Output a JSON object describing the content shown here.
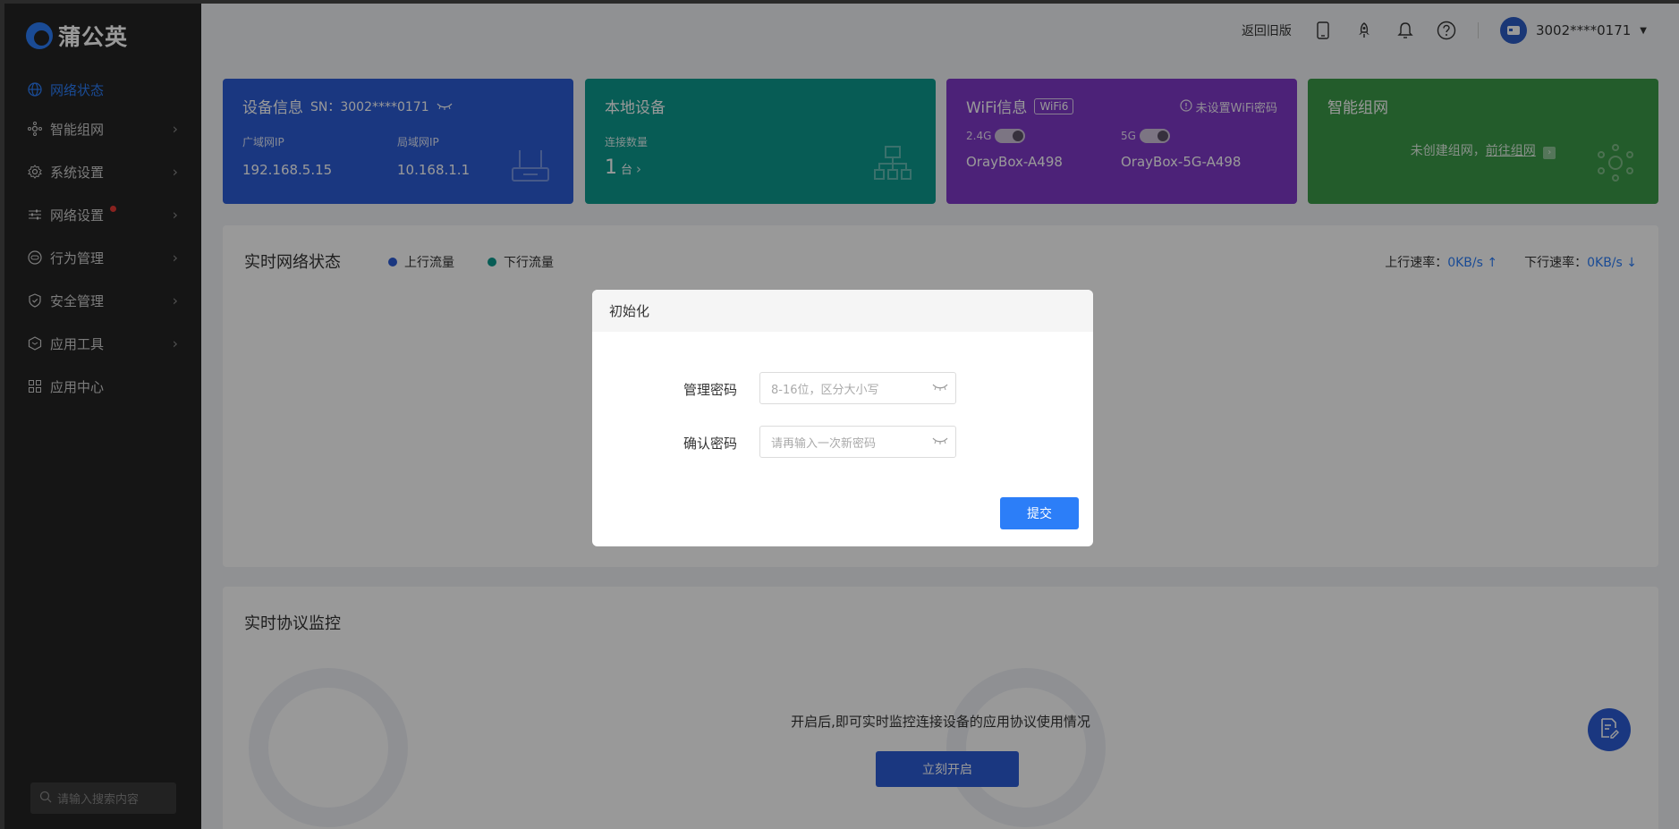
{
  "app": {
    "brand": "蒲公英"
  },
  "sidebar": {
    "items": [
      {
        "label": "网络状态",
        "active": true
      },
      {
        "label": "智能组网"
      },
      {
        "label": "系统设置"
      },
      {
        "label": "网络设置",
        "has_dot": true
      },
      {
        "label": "行为管理"
      },
      {
        "label": "安全管理"
      },
      {
        "label": "应用工具"
      },
      {
        "label": "应用中心"
      }
    ],
    "search_placeholder": "请输入搜索内容"
  },
  "topbar": {
    "back_label": "返回旧版",
    "username": "3002****0171"
  },
  "cards": {
    "device": {
      "title": "设备信息",
      "sn": "SN：3002****0171",
      "wan_label": "广域网IP",
      "wan_value": "192.168.5.15",
      "lan_label": "局域网IP",
      "lan_value": "10.168.1.1"
    },
    "local": {
      "title": "本地设备",
      "count_label": "连接数量",
      "count_value": "1",
      "count_unit": "台"
    },
    "wifi": {
      "title": "WiFi信息",
      "badge": "WiFi6",
      "warning": "未设置WiFi密码",
      "band1": "2.4G",
      "band2": "5G",
      "ssid1": "OrayBox-A498",
      "ssid2": "OrayBox-5G-A498"
    },
    "smart": {
      "title": "智能组网",
      "text": "未创建组网，",
      "link": "前往组网"
    }
  },
  "realtime": {
    "title": "实时网络状态",
    "legend_up": "上行流量",
    "legend_down": "下行流量",
    "up_label": "上行速率：",
    "up_value": "0KB/s",
    "down_label": "下行速率：",
    "down_value": "0KB/s"
  },
  "protocol": {
    "title": "实时协议监控",
    "message": "开启后,即可实时监控连接设备的应用协议使用情况",
    "button": "立刻开启"
  },
  "modal": {
    "title": "初始化",
    "pw_label": "管理密码",
    "pw_placeholder": "8-16位，区分大小写",
    "confirm_label": "确认密码",
    "confirm_placeholder": "请再输入一次新密码",
    "submit": "提交"
  },
  "colors": {
    "accent": "#2c7ef8",
    "card_device": "#2c5cd6",
    "card_local": "#0d9a8e",
    "card_wifi": "#7f39c9",
    "card_smart": "#3b9a48",
    "sidebar_bg": "#232323"
  }
}
